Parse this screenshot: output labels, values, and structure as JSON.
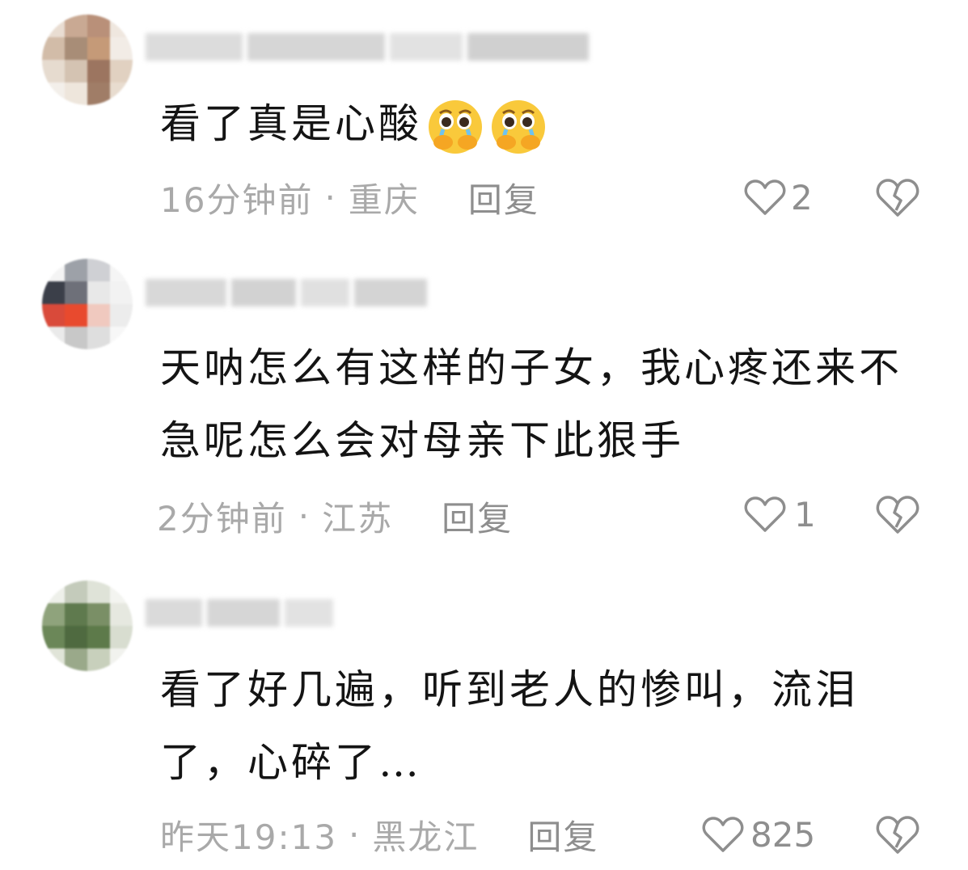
{
  "comments": [
    {
      "text": "看了真是心酸",
      "time": "16分钟前",
      "location": "重庆",
      "reply_label": "回复",
      "likes": "2",
      "emoji_count": 2,
      "emoji": "crying-face-emoji"
    },
    {
      "text": "天呐怎么有这样的子女，我心疼还来不急呢怎么会对母亲下此狠手",
      "time": "2分钟前",
      "location": "江苏",
      "reply_label": "回复",
      "likes": "1"
    },
    {
      "text": "看了好几遍，听到老人的惨叫，流泪了，心碎了…",
      "time": "昨天19:13",
      "location": "黑龙江",
      "reply_label": "回复",
      "likes": "825"
    }
  ],
  "colors": {
    "text": "#141414",
    "meta": "#a9a9a9",
    "icon": "#8e8e8e"
  },
  "icons": {
    "like": "heart-outline-icon",
    "dislike": "broken-heart-icon"
  }
}
